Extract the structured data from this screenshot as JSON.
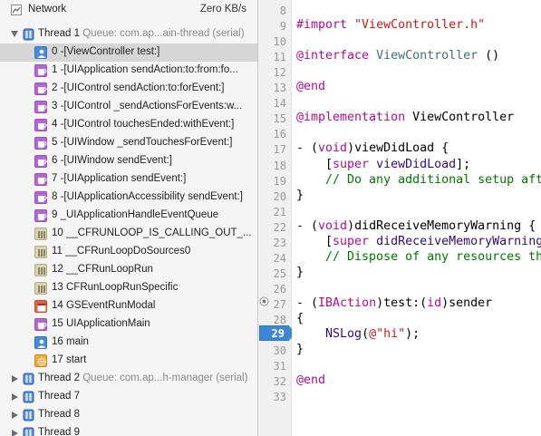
{
  "network": {
    "label": "Network",
    "value": "Zero KB/s"
  },
  "threads": [
    {
      "name": "Thread 1",
      "queue": "Queue: com.ap...ain-thread (serial)",
      "expanded": true
    },
    {
      "name": "Thread 2",
      "queue": "Queue: com.ap...h-manager (serial)",
      "expanded": false
    },
    {
      "name": "Thread 7",
      "queue": "",
      "expanded": false
    },
    {
      "name": "Thread 8",
      "queue": "",
      "expanded": false
    },
    {
      "name": "Thread 9",
      "queue": "",
      "expanded": false
    }
  ],
  "frames": [
    {
      "label": "0 -[ViewController test:]",
      "icon": "person-icon",
      "color": "blue",
      "selected": true
    },
    {
      "label": "1 -[UIApplication sendAction:to:from:fo...",
      "icon": "cup-icon",
      "color": "purple"
    },
    {
      "label": "2 -[UIControl sendAction:to:forEvent:]",
      "icon": "cup-icon",
      "color": "purple"
    },
    {
      "label": "3 -[UIControl _sendActionsForEvents:w...",
      "icon": "cup-icon",
      "color": "purple"
    },
    {
      "label": "4 -[UIControl touchesEnded:withEvent:]",
      "icon": "cup-icon",
      "color": "purple"
    },
    {
      "label": "5 -[UIWindow _sendTouchesForEvent:]",
      "icon": "cup-icon",
      "color": "purple"
    },
    {
      "label": "6 -[UIWindow sendEvent:]",
      "icon": "cup-icon",
      "color": "purple"
    },
    {
      "label": "7 -[UIApplication sendEvent:]",
      "icon": "cup-icon",
      "color": "purple"
    },
    {
      "label": "8 -[UIApplicationAccessibility sendEvent:]",
      "icon": "cup-icon",
      "color": "purple"
    },
    {
      "label": "9 _UIApplicationHandleEventQueue",
      "icon": "cup-icon",
      "color": "purple"
    },
    {
      "label": "10 __CFRUNLOOP_IS_CALLING_OUT_...",
      "icon": "column-icon",
      "color": "khaki"
    },
    {
      "label": "11 __CFRunLoopDoSources0",
      "icon": "column-icon",
      "color": "khaki"
    },
    {
      "label": "12 __CFRunLoopRun",
      "icon": "column-icon",
      "color": "khaki"
    },
    {
      "label": "13 CFRunLoopRunSpecific",
      "icon": "column-icon",
      "color": "khaki"
    },
    {
      "label": "14 GSEventRunModal",
      "icon": "calendar-icon",
      "color": "red"
    },
    {
      "label": "15 UIApplicationMain",
      "icon": "cup-icon",
      "color": "purple"
    },
    {
      "label": "16 main",
      "icon": "person-icon",
      "color": "blue"
    },
    {
      "label": "17 start",
      "icon": "gear-icon",
      "color": "orange"
    }
  ],
  "editor": {
    "current_line": "29",
    "lines": [
      {
        "n": "8"
      },
      {
        "n": "9",
        "parts": [
          [
            "#import ",
            "k"
          ],
          [
            "\"ViewController.h\"",
            "s"
          ]
        ]
      },
      {
        "n": "10"
      },
      {
        "n": "11",
        "parts": [
          [
            "@interface ",
            "k"
          ],
          [
            "ViewController",
            "t"
          ],
          [
            " ()",
            ""
          ]
        ]
      },
      {
        "n": "12"
      },
      {
        "n": "13",
        "parts": [
          [
            "@end",
            "k"
          ]
        ]
      },
      {
        "n": "14"
      },
      {
        "n": "15",
        "parts": [
          [
            "@implementation ",
            "k"
          ],
          [
            "ViewController",
            ""
          ]
        ]
      },
      {
        "n": "16"
      },
      {
        "n": "17",
        "parts": [
          [
            "- (",
            ""
          ],
          [
            "void",
            "k"
          ],
          [
            ")viewDidLoad {",
            ""
          ]
        ]
      },
      {
        "n": "18",
        "parts": [
          [
            "    [",
            ""
          ],
          [
            "super ",
            "k"
          ],
          [
            "viewDidLoad",
            "m"
          ],
          [
            "];",
            ""
          ]
        ]
      },
      {
        "n": "19",
        "parts": [
          [
            "    // Do any additional setup aft",
            "c"
          ]
        ]
      },
      {
        "n": "20",
        "parts": [
          [
            "}",
            ""
          ]
        ]
      },
      {
        "n": "21"
      },
      {
        "n": "22",
        "parts": [
          [
            "- (",
            ""
          ],
          [
            "void",
            "k"
          ],
          [
            ")didReceiveMemoryWarning {",
            ""
          ]
        ]
      },
      {
        "n": "23",
        "parts": [
          [
            "    [",
            ""
          ],
          [
            "super ",
            "k"
          ],
          [
            "didReceiveMemoryWarning",
            "m"
          ]
        ]
      },
      {
        "n": "24",
        "parts": [
          [
            "    // Dispose of any resources th",
            "c"
          ]
        ]
      },
      {
        "n": "25",
        "parts": [
          [
            "}",
            ""
          ]
        ]
      },
      {
        "n": "26"
      },
      {
        "n": "27",
        "parts": [
          [
            "- (",
            ""
          ],
          [
            "IBAction",
            "k"
          ],
          [
            ")test:(",
            ""
          ],
          [
            "id",
            "k"
          ],
          [
            ")sender",
            ""
          ]
        ]
      },
      {
        "n": "28",
        "parts": [
          [
            "{",
            ""
          ]
        ]
      },
      {
        "n": "29",
        "parts": [
          [
            "    ",
            ""
          ],
          [
            "NSLog",
            "m"
          ],
          [
            "(",
            ""
          ],
          [
            "@\"hi\"",
            "s"
          ],
          [
            ");",
            ""
          ]
        ]
      },
      {
        "n": "30",
        "parts": [
          [
            "}",
            ""
          ]
        ]
      },
      {
        "n": "31"
      },
      {
        "n": "32",
        "parts": [
          [
            "@end",
            "k"
          ]
        ]
      },
      {
        "n": "33"
      }
    ]
  },
  "colors": {
    "keyword": "#aa0d91",
    "string": "#c41a16",
    "comment": "#007400",
    "breakpoint": "#3d85d6",
    "current_line": "#e3f1d8"
  }
}
